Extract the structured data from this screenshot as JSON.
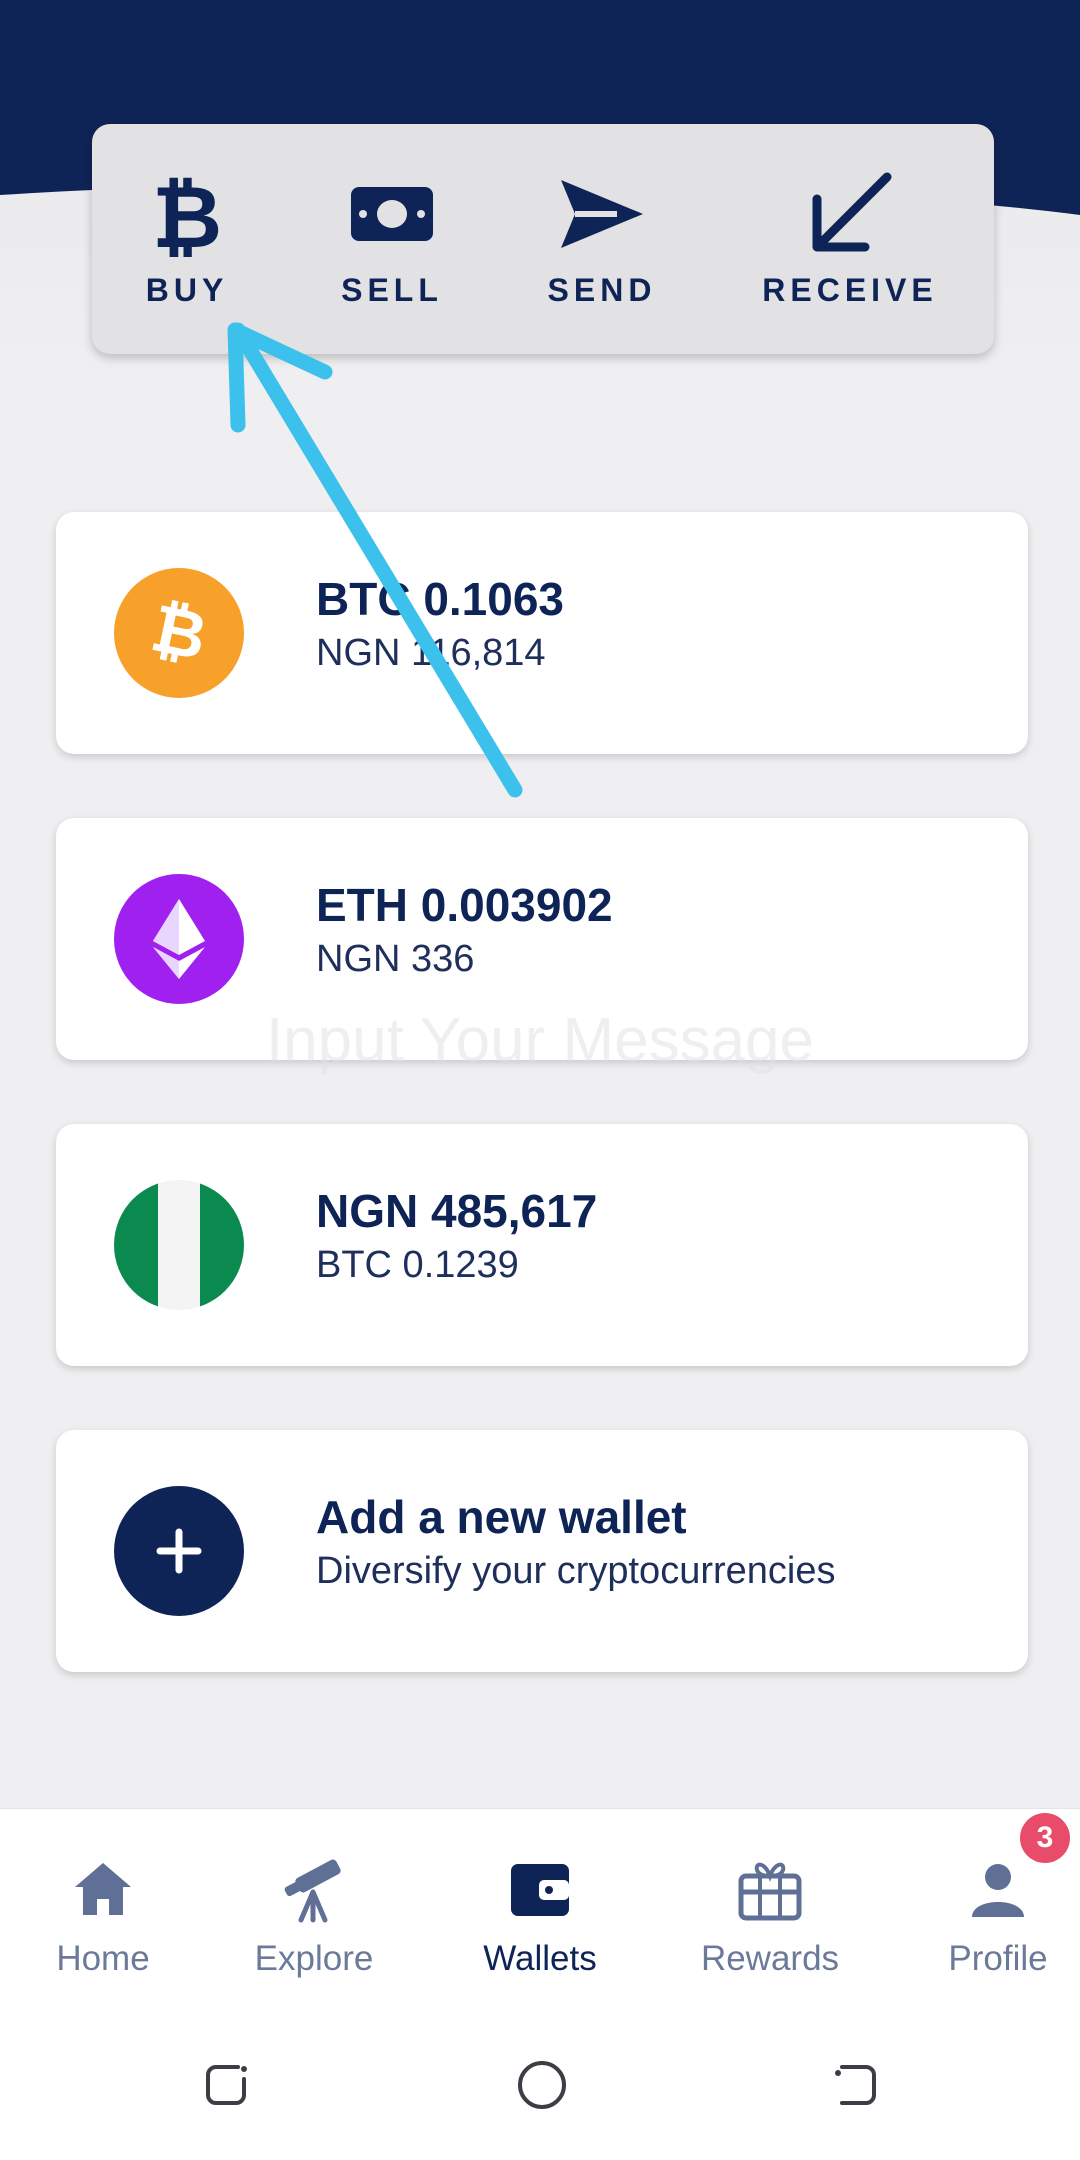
{
  "actions": [
    {
      "label": "BUY",
      "icon": "bitcoin-icon"
    },
    {
      "label": "SELL",
      "icon": "cash-icon"
    },
    {
      "label": "SEND",
      "icon": "send-icon"
    },
    {
      "label": "RECEIVE",
      "icon": "receive-arrow-icon"
    }
  ],
  "wallets": [
    {
      "title": "BTC 0.1063",
      "subtitle": "NGN 116,814",
      "icon": "bitcoin-coin-icon",
      "color": "#f7a02a"
    },
    {
      "title": "ETH 0.003902",
      "subtitle": "NGN 336",
      "icon": "ethereum-coin-icon",
      "color": "#a020f0"
    },
    {
      "title": "NGN 485,617",
      "subtitle": "BTC 0.1239",
      "icon": "nigeria-flag-icon",
      "color": "#0b8a4f"
    }
  ],
  "add_wallet": {
    "title": "Add a new wallet",
    "subtitle": "Diversify your cryptocurrencies",
    "icon": "plus-icon"
  },
  "watermark": "Input Your Message",
  "nav": [
    {
      "label": "Home",
      "icon": "home-icon"
    },
    {
      "label": "Explore",
      "icon": "telescope-icon"
    },
    {
      "label": "Wallets",
      "icon": "wallet-icon",
      "active": true
    },
    {
      "label": "Rewards",
      "icon": "gift-icon"
    },
    {
      "label": "Profile",
      "icon": "profile-icon",
      "badge": "3"
    }
  ],
  "colors": {
    "navy": "#0f2456",
    "accent_annotation": "#3cc0ec",
    "badge": "#e84c6a"
  }
}
